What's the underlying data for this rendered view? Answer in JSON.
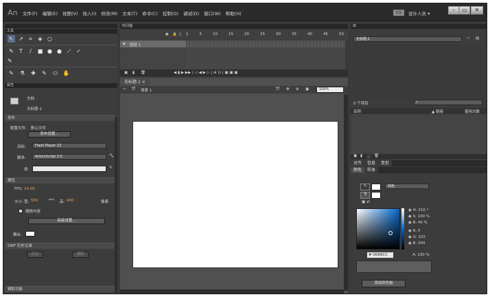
{
  "app": {
    "logo": "An"
  },
  "menu": [
    "文件(F)",
    "编辑(E)",
    "视图(V)",
    "插入(I)",
    "修改(M)",
    "文本(T)",
    "命令(C)",
    "控制(O)",
    "调试(D)",
    "窗口(W)",
    "帮助(H)"
  ],
  "workspace": {
    "badge": "CS",
    "label": "设计人员 ▾"
  },
  "window_buttons": {
    "minimize": "–",
    "restore": "▭",
    "close": "✕"
  },
  "tools": {
    "header": "工具",
    "row1": [
      "↖",
      "↗",
      "⌗",
      "◈",
      "○"
    ],
    "row2": [
      "✎",
      "T",
      "/",
      "■",
      "●",
      "●",
      "⟋",
      "✓"
    ],
    "row3": [
      "✎"
    ],
    "row4": [
      "✎",
      "⚗",
      "✚",
      "✎",
      "⬭",
      "✋"
    ]
  },
  "properties": {
    "header": "属性",
    "doc_type": "文档",
    "doc_name": "无标题-1",
    "publish_section": "发布",
    "profile_label": "配置文件:",
    "profile_value": "默认文件",
    "publish_settings": "发布设置...",
    "target_label": "目标:",
    "target_value": "Flash Player 23",
    "script_label": "脚本:",
    "script_value": "ActionScript 3.0",
    "class_label": "类:",
    "attributes_section": "属性",
    "fps_label": "FPS:",
    "fps_value": "24.00",
    "size_label": "大小:",
    "width_label": "宽:",
    "width_value": "550",
    "height_label": "高:",
    "height_value": "400",
    "size_unit": "像素",
    "scale_content": "缩放内容",
    "advanced_settings": "高级设置...",
    "stage_label": "舞台:",
    "swf_history_section": "SWF 历史记录",
    "log_button": "日志",
    "clear_button": "清除",
    "accessibility_section": "辅助功能"
  },
  "timeline": {
    "header": "时间轴",
    "ruler": [
      "1",
      "5",
      "10",
      "15",
      "20",
      "25",
      "30",
      "35",
      "40",
      "45",
      "50"
    ],
    "layer_name": "图层 1",
    "footer_icons": "◀ ▮ ▶ ▶▶ | ◁ ◀ ▶ ▷ | ⊕ ⊡ | ▣ ▣ ▣"
  },
  "document": {
    "tab": "无标题-1 ×",
    "scene": "场景 1",
    "zoom": "100%"
  },
  "library": {
    "header": "库",
    "document_select": "无标题-1",
    "search_placeholder": "",
    "items_label": "0 个项目",
    "col_name": "名称",
    "col_linkage": "▲ 链接",
    "col_usage": "使用次数"
  },
  "color_panel": {
    "tabs": [
      "对齐",
      "信息",
      "变形"
    ],
    "active_tabs": [
      "颜色",
      "样本"
    ],
    "type_value": "纯色",
    "H": "H: 210 °",
    "S": "S: 100 %",
    "B": "B: 40 %",
    "R": "R: 0",
    "G": "G: 102",
    "Bv": "B: 204",
    "hex": "# 0066CC",
    "alpha": "A: 100 %",
    "add_swatch": "添加到色板",
    "colors": {
      "hex": "#0066cc"
    }
  }
}
